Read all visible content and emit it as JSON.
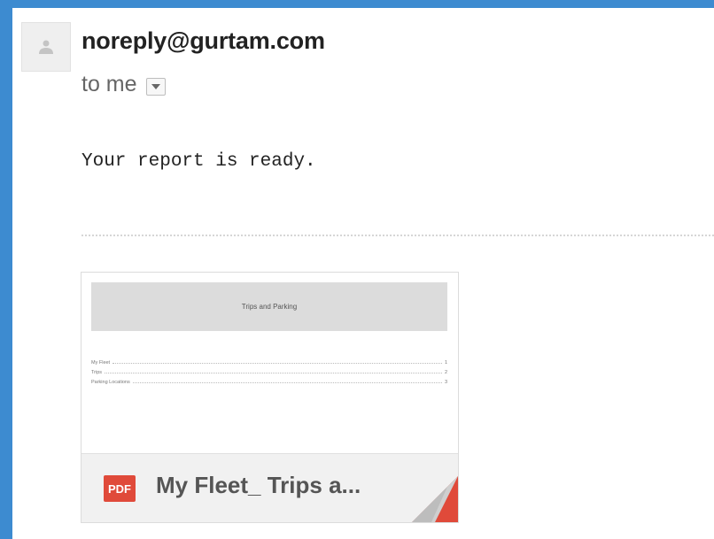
{
  "message": {
    "sender": "noreply@gurtam.com",
    "recipient": "to me",
    "body": "Your report is ready."
  },
  "attachment": {
    "type_badge": "PDF",
    "file_name": "My Fleet_ Trips a...",
    "preview": {
      "title": "Trips and Parking",
      "toc": [
        {
          "label": "My Fleet",
          "page": "1"
        },
        {
          "label": "Trips",
          "page": "2"
        },
        {
          "label": "Parking Locations",
          "page": "3"
        }
      ]
    }
  },
  "colors": {
    "background": "#3d8bd0",
    "pdf_red": "#e04a3a"
  },
  "icons": {
    "avatar": "person-silhouette-icon",
    "dropdown": "caret-down-icon"
  }
}
